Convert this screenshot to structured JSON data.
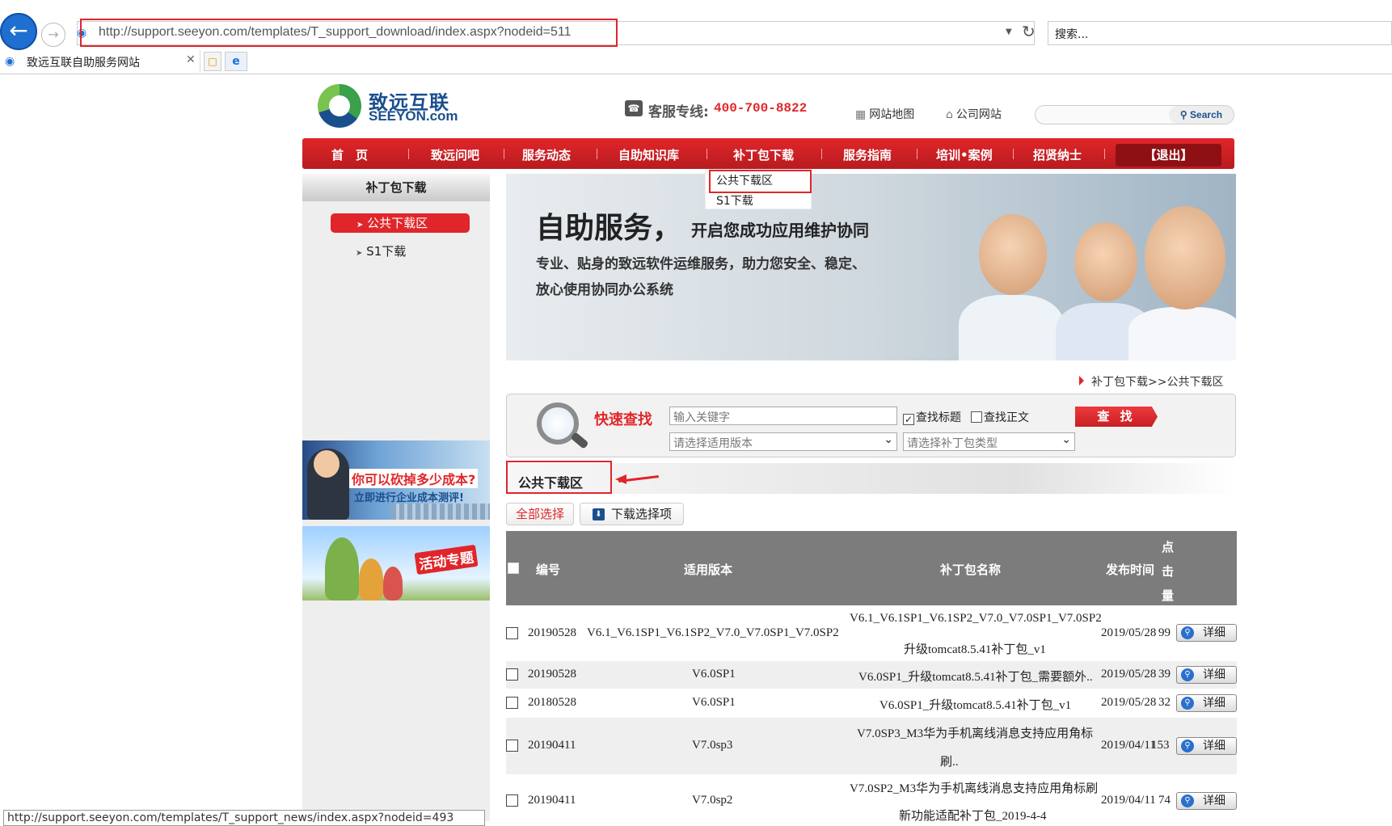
{
  "browser": {
    "url": "http://support.seeyon.com/templates/T_support_download/index.aspx?nodeid=511",
    "search_placeholder": "搜索...",
    "tab_title": "致远互联自助服务网站",
    "status_url": "http://support.seeyon.com/templates/T_support_news/index.aspx?nodeid=493"
  },
  "header": {
    "logo_cn": "致远互联",
    "logo_en": "SEEYON.com",
    "hotline_label": "客服专线:",
    "hotline_number": "400-700-8822",
    "links": [
      "网站地图",
      "公司网站"
    ],
    "search_button": "Search"
  },
  "nav": {
    "items": [
      "首　页",
      "致远问吧",
      "服务动态",
      "自助知识库",
      "补丁包下载",
      "服务指南",
      "培训•案例",
      "招贤纳士"
    ],
    "logout": "【退出】",
    "dropdown": [
      "公共下载区",
      "S1下载"
    ]
  },
  "sidebar": {
    "title": "补丁包下载",
    "items": [
      "公共下载区",
      "S1下载"
    ],
    "ad1_line1": "你可以砍掉多少成本?",
    "ad1_line2": "立即进行企业成本测评!",
    "ad2_text": "活动专题"
  },
  "banner": {
    "headline": "自助服务，",
    "headline_sub": "开启您成功应用维护协同",
    "line1": "专业、贴身的致远软件运维服务，助力您安全、稳定、",
    "line2": "放心使用协同办公系统"
  },
  "breadcrumb": "补丁包下载>>公共下载区",
  "quick_search": {
    "label": "快速查找",
    "keyword_placeholder": "输入关键字",
    "check_title": "查找标题",
    "check_title_checked": true,
    "check_body": "查找正文",
    "check_body_checked": false,
    "button": "查 找",
    "version_select": "请选择适用版本",
    "type_select": "请选择补丁包类型"
  },
  "section": {
    "title": "公共下载区",
    "select_all": "全部选择",
    "download_selected": "下载选择项"
  },
  "table": {
    "headers": {
      "id": "编号",
      "version": "适用版本",
      "name": "补丁包名称",
      "date": "发布时间",
      "clicks": "点击量"
    },
    "detail_label": "详细",
    "rows": [
      {
        "id": "20190528",
        "version": "V6.1_V6.1SP1_V6.1SP2_V7.0_V7.0SP1_V7.0SP2",
        "name1": "V6.1_V6.1SP1_V6.1SP2_V7.0_V7.0SP1_V7.0SP2",
        "name2": "升级tomcat8.5.41补丁包_v1",
        "date": "2019/05/28",
        "clicks": "99"
      },
      {
        "id": "20190528",
        "version": "V6.0SP1",
        "name1": "V6.0SP1_升级tomcat8.5.41补丁包_需要额外..",
        "name2": "",
        "date": "2019/05/28",
        "clicks": "39"
      },
      {
        "id": "20180528",
        "version": "V6.0SP1",
        "name1": "V6.0SP1_升级tomcat8.5.41补丁包_v1",
        "name2": "",
        "date": "2019/05/28",
        "clicks": "32"
      },
      {
        "id": "20190411",
        "version": "V7.0sp3",
        "name1": "V7.0SP3_M3华为手机离线消息支持应用角标",
        "name2": "刷..",
        "date": "2019/04/11",
        "clicks": "153"
      },
      {
        "id": "20190411",
        "version": "V7.0sp2",
        "name1": "V7.0SP2_M3华为手机离线消息支持应用角标刷",
        "name2": "新功能适配补丁包_2019-4-4",
        "date": "2019/04/11",
        "clicks": "74"
      }
    ]
  }
}
